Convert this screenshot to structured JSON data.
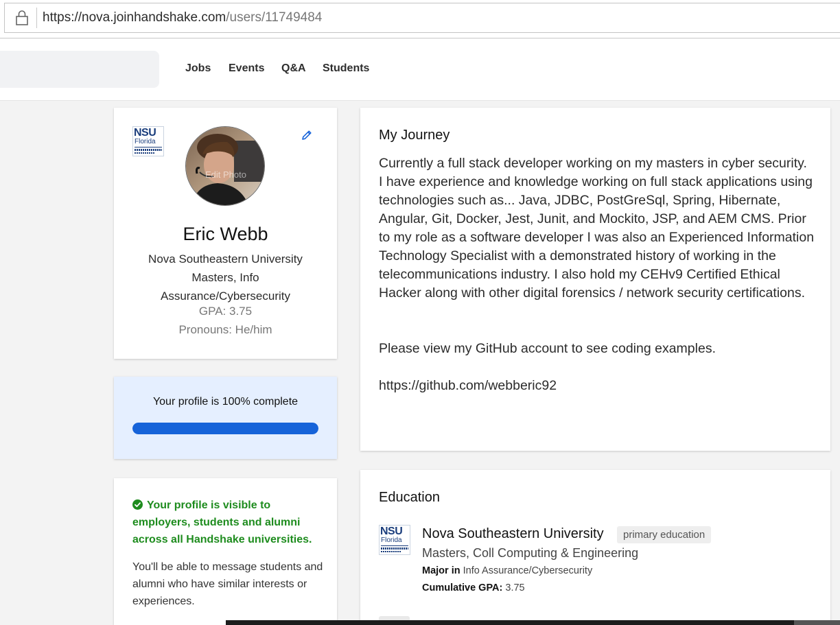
{
  "browser": {
    "url_host": "https://nova.joinhandshake.com",
    "url_path": "/users/11749484"
  },
  "nav": {
    "items": [
      "Jobs",
      "Events",
      "Q&A",
      "Students"
    ]
  },
  "profile": {
    "logo_text": "NSU",
    "logo_sub": "Florida",
    "edit_photo": "Edit Photo",
    "name": "Eric Webb",
    "school_lines": [
      "Nova Southeastern University",
      "Masters, Info",
      "Assurance/Cybersecurity"
    ],
    "gpa": "GPA: 3.75",
    "pronouns": "Pronouns: He/him"
  },
  "progress": {
    "text": "Your profile is 100% complete",
    "percent": 100,
    "color": "#1663d9"
  },
  "visibility": {
    "headline": "Your profile is visible to employers, students and alumni across all Handshake universities.",
    "body": "You'll be able to message students and alumni who have similar interests or experiences.",
    "color": "#1e8c1e"
  },
  "journey": {
    "title": "My Journey",
    "paragraph1": "Currently a full stack developer working on my masters in cyber security.",
    "paragraph2": "I have experience and knowledge working on full stack applications using technologies such as... Java, JDBC, PostGreSql, Spring, Hibernate, Angular, Git, Docker, Jest, Junit, and Mockito, JSP, and AEM CMS. Prior to my role as a software developer I was also an Experienced Information Technology Specialist with a demonstrated history of working in the telecommunications industry. I also hold my CEHv9 Certified Ethical Hacker along with other digital forensics / network security certifications.",
    "paragraph3": "Please view my GitHub account to see coding examples.",
    "link": "https://github.com/webberic92"
  },
  "education": {
    "title": "Education",
    "logo_text": "NSU",
    "logo_sub": "Florida",
    "school": "Nova Southeastern University",
    "badge": "primary education",
    "degree": "Masters, Coll Computing & Engineering",
    "major_label": "Major in",
    "major_value": " Info Assurance/Cybersecurity",
    "gpa_label": "Cumulative GPA:",
    "gpa_value": " 3.75"
  }
}
